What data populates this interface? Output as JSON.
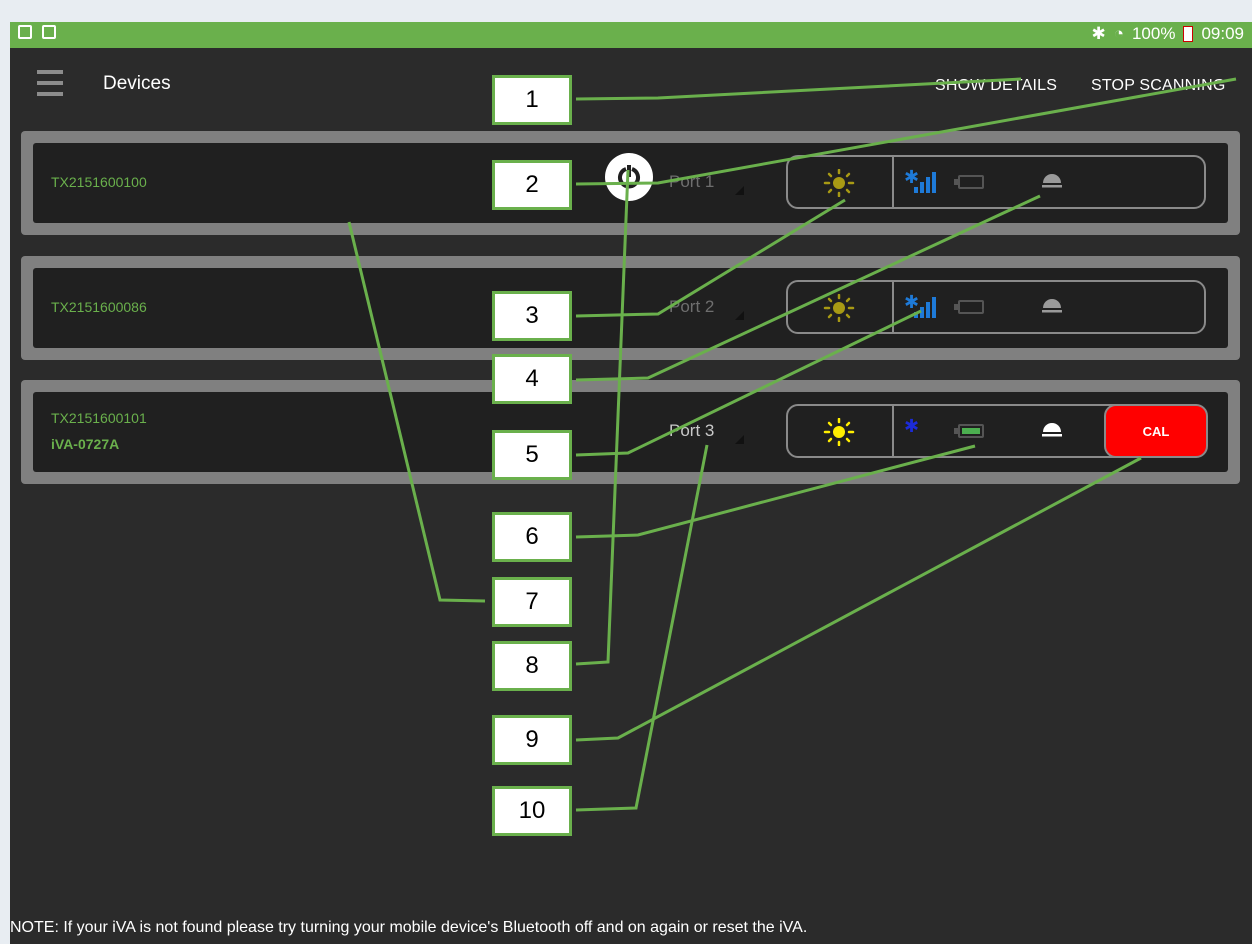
{
  "statusbar": {
    "left_icons": [
      "phone-icon",
      "clipboard-icon"
    ],
    "bluetooth": "bluetooth-icon",
    "wifi": "wifi-icon",
    "battery": "100%",
    "time": "09:09"
  },
  "appbar": {
    "menu_icon": "hamburger-menu-icon",
    "title": "Devices",
    "show_details": "SHOW DETAILS",
    "stop_scanning": "STOP SCANNING"
  },
  "devices": [
    {
      "id": "TX2151600100",
      "name": "",
      "port": "Port 1",
      "port_color": "#6e6e6e",
      "sun_color": "#a89a14",
      "signal_level": 4,
      "battery_level": 0,
      "dome_color": "#9a9a9a",
      "bluetooth_color": "#1e7ad8",
      "cal": ""
    },
    {
      "id": "TX2151600086",
      "name": "",
      "port": "Port 2",
      "port_color": "#6e6e6e",
      "sun_color": "#a89a14",
      "signal_level": 4,
      "battery_level": 0,
      "dome_color": "#9a9a9a",
      "bluetooth_color": "#1e7ad8",
      "cal": ""
    },
    {
      "id": "TX2151600101",
      "name": "iVA-0727A",
      "port": "Port 3",
      "port_color": "#c9c9c9",
      "sun_color": "#ffee00",
      "signal_level": 0,
      "battery_level": 1,
      "dome_color": "#ffffff",
      "bluetooth_color": "#1c2bd8",
      "cal": "CAL"
    }
  ],
  "note": "NOTE: If your iVA is not found please try turning your mobile device's Bluetooth off and on again or reset the iVA.",
  "annotations": [
    "1",
    "2",
    "3",
    "4",
    "5",
    "6",
    "7",
    "8",
    "9",
    "10"
  ],
  "colors": {
    "accent": "#6ab04c",
    "background": "#2b2b2b",
    "card_border": "#808080",
    "cal_button": "#ff0000"
  }
}
